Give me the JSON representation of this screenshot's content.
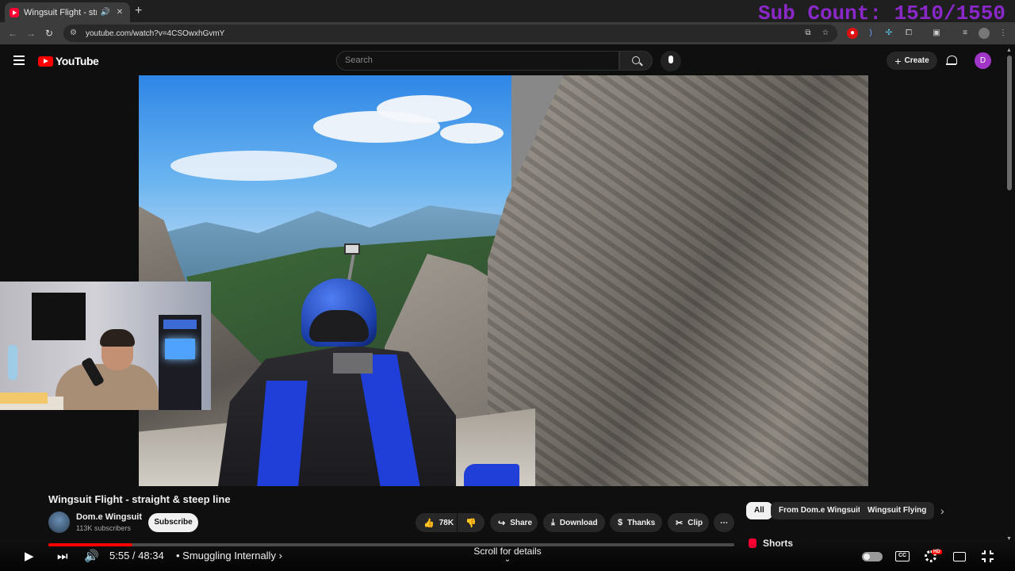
{
  "browser": {
    "tab_title": "Wingsuit Flight - straight &",
    "url": "youtube.com/watch?v=4CSOwxhGvmY",
    "new_tab": "+",
    "close": "✕"
  },
  "overlay": {
    "sub_count": "Sub Count: 1510/1550"
  },
  "masthead": {
    "logo_text": "YouTube",
    "search_placeholder": "Search",
    "create_label": "Create",
    "avatar_letter": "D"
  },
  "video": {
    "title": "Wingsuit Flight - straight & steep line",
    "channel_name": "Dom.e Wingsuit",
    "subscribers": "113K subscribers",
    "subscribe_label": "Subscribe",
    "likes": "78K",
    "share_label": "Share",
    "download_label": "Download",
    "thanks_label": "Thanks",
    "clip_label": "Clip",
    "more_label": "⋯"
  },
  "player": {
    "time": "5:55 / 48:34",
    "chapter": "• Smuggling Internally",
    "progress_fraction": 0.122,
    "scroll_hint": "Scroll for details",
    "hd_badge": "HD",
    "cc_label": "CC"
  },
  "related": {
    "chips": [
      "All",
      "From Dom.e Wingsuit",
      "Wingsuit Flying"
    ],
    "active_chip": 0,
    "shorts_label": "Shorts"
  },
  "colors": {
    "accent": "#ff0000",
    "sub_count": "#8b28c9",
    "avatar": "#a035c8"
  }
}
